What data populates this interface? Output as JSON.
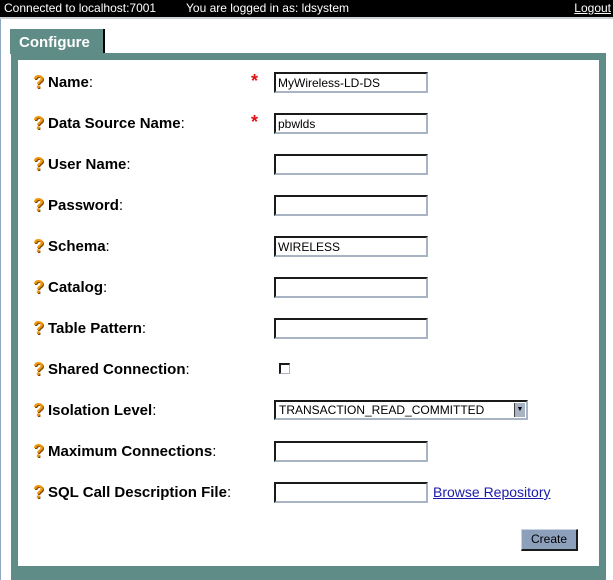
{
  "topbar": {
    "connection": "Connected to localhost:7001",
    "logged_in": "You are logged in as: ldsystem",
    "logout": "Logout"
  },
  "tab": {
    "label": "Configure"
  },
  "colors": {
    "panel": "#5f8c87",
    "required": "#e01010",
    "help": "#f0960e",
    "link": "#1a1aaa",
    "button": "#8ca0bc"
  },
  "form": {
    "help_glyph": "?",
    "required_glyph": "*",
    "colon": ":",
    "fields": [
      {
        "label": "Name",
        "value": "MyWireless-LD-DS",
        "required": true
      },
      {
        "label": "Data Source Name",
        "value": "pbwlds",
        "required": true
      },
      {
        "label": "User Name",
        "value": ""
      },
      {
        "label": "Password",
        "value": ""
      },
      {
        "label": "Schema",
        "value": "WIRELESS"
      },
      {
        "label": "Catalog",
        "value": ""
      },
      {
        "label": "Table Pattern",
        "value": ""
      },
      {
        "label": "Shared Connection",
        "checked": false
      },
      {
        "label": "Isolation Level",
        "selected": "TRANSACTION_READ_COMMITTED"
      },
      {
        "label": "Maximum Connections",
        "value": ""
      },
      {
        "label": "SQL Call Description File",
        "value": ""
      }
    ],
    "browse_link": "Browse Repository",
    "create_button": "Create"
  }
}
